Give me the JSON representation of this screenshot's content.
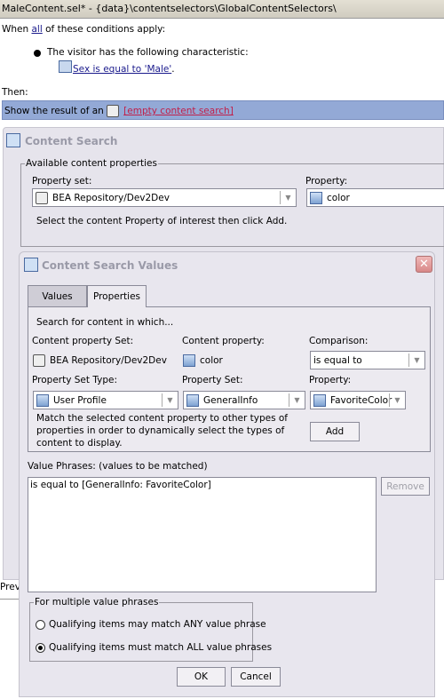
{
  "window": {
    "title": "MaleContent.sel* - {data}\\contentselectors\\GlobalContentSelectors\\"
  },
  "editor": {
    "when_prefix": "When ",
    "when_link": "all",
    "when_suffix": " of these conditions apply:",
    "condition": "The visitor has the following characteristic:",
    "condition_link": "Sex is equal to 'Male'",
    "condition_end": ".",
    "then": "Then:",
    "show_prefix": "Show the result of an ",
    "show_link": "[empty content search]",
    "behind_text": "Prev"
  },
  "content_search": {
    "title": "Content Search",
    "group": "Available content properties",
    "property_set_label": "Property set:",
    "property_set_value": "BEA Repository/Dev2Dev",
    "property_label": "Property:",
    "property_value": "color",
    "help": "Select the content Property of interest then click Add."
  },
  "dialog": {
    "title": "Content Search Values",
    "tabs": [
      {
        "label": "Values",
        "selected": false
      },
      {
        "label": "Properties",
        "selected": true
      }
    ],
    "intro": "Search for content in which...",
    "content_property_set_label": "Content property Set:",
    "content_property_set_value": "BEA Repository/Dev2Dev",
    "content_property_label": "Content property:",
    "content_property_value": "color",
    "comparison_label": "Comparison:",
    "comparison_value": "is equal to",
    "property_set_type_label": "Property Set Type:",
    "property_set_type_value": "User Profile",
    "property_set_label": "Property Set:",
    "property_set_value": "GeneralInfo",
    "property_label": "Property:",
    "property_value": "FavoriteColor",
    "match_help": "Match the selected content property to other types of properties in order to dynamically select the types of content to display.",
    "add": "Add",
    "value_phrases_label": "Value Phrases:  (values to be matched)",
    "value_phrases": [
      "is equal to [GeneralInfo: FavoriteColor]"
    ],
    "remove": "Remove",
    "multi_group": "For multiple value phrases",
    "radio_any": "Qualifying items may match ANY value phrase",
    "radio_all": "Qualifying items must match ALL value phrases",
    "selected_radio": "all",
    "ok": "OK",
    "cancel": "Cancel"
  }
}
